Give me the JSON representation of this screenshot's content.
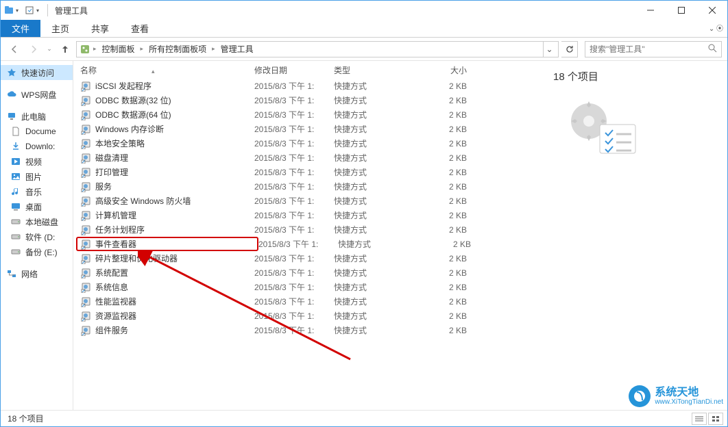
{
  "window": {
    "title": "管理工具",
    "minimize": "最小化",
    "maximize": "最大化",
    "close": "关闭"
  },
  "ribbon": {
    "file": "文件",
    "home": "主页",
    "share": "共享",
    "view": "查看"
  },
  "address": {
    "crumbs": [
      "控制面板",
      "所有控制面板项",
      "管理工具"
    ]
  },
  "search": {
    "placeholder": "搜索\"管理工具\""
  },
  "sidebar": {
    "quick_access": "快速访问",
    "wps": "WPS网盘",
    "this_pc": "此电脑",
    "documents": "Docume",
    "downloads": "Downlo:",
    "videos": "视频",
    "pictures": "图片",
    "music": "音乐",
    "desktop": "桌面",
    "local_disk": "本地磁盘",
    "software": "软件 (D:",
    "backup": "备份 (E:)",
    "network": "网络"
  },
  "columns": {
    "name": "名称",
    "date": "修改日期",
    "type": "类型",
    "size": "大小"
  },
  "files": [
    {
      "name": "iSCSI 发起程序",
      "date": "2015/8/3 下午 1:",
      "type": "快捷方式",
      "size": "2 KB",
      "hl": false
    },
    {
      "name": "ODBC 数据源(32 位)",
      "date": "2015/8/3 下午 1:",
      "type": "快捷方式",
      "size": "2 KB",
      "hl": false
    },
    {
      "name": "ODBC 数据源(64 位)",
      "date": "2015/8/3 下午 1:",
      "type": "快捷方式",
      "size": "2 KB",
      "hl": false
    },
    {
      "name": "Windows 内存诊断",
      "date": "2015/8/3 下午 1:",
      "type": "快捷方式",
      "size": "2 KB",
      "hl": false
    },
    {
      "name": "本地安全策略",
      "date": "2015/8/3 下午 1:",
      "type": "快捷方式",
      "size": "2 KB",
      "hl": false
    },
    {
      "name": "磁盘清理",
      "date": "2015/8/3 下午 1:",
      "type": "快捷方式",
      "size": "2 KB",
      "hl": false
    },
    {
      "name": "打印管理",
      "date": "2015/8/3 下午 1:",
      "type": "快捷方式",
      "size": "2 KB",
      "hl": false
    },
    {
      "name": "服务",
      "date": "2015/8/3 下午 1:",
      "type": "快捷方式",
      "size": "2 KB",
      "hl": false
    },
    {
      "name": "高级安全 Windows 防火墙",
      "date": "2015/8/3 下午 1:",
      "type": "快捷方式",
      "size": "2 KB",
      "hl": false
    },
    {
      "name": "计算机管理",
      "date": "2015/8/3 下午 1:",
      "type": "快捷方式",
      "size": "2 KB",
      "hl": false
    },
    {
      "name": "任务计划程序",
      "date": "2015/8/3 下午 1:",
      "type": "快捷方式",
      "size": "2 KB",
      "hl": false
    },
    {
      "name": "事件查看器",
      "date": "2015/8/3 下午 1:",
      "type": "快捷方式",
      "size": "2 KB",
      "hl": true
    },
    {
      "name": "碎片整理和优化驱动器",
      "date": "2015/8/3 下午 1:",
      "type": "快捷方式",
      "size": "2 KB",
      "hl": false
    },
    {
      "name": "系统配置",
      "date": "2015/8/3 下午 1:",
      "type": "快捷方式",
      "size": "2 KB",
      "hl": false
    },
    {
      "name": "系统信息",
      "date": "2015/8/3 下午 1:",
      "type": "快捷方式",
      "size": "2 KB",
      "hl": false
    },
    {
      "name": "性能监视器",
      "date": "2015/8/3 下午 1:",
      "type": "快捷方式",
      "size": "2 KB",
      "hl": false
    },
    {
      "name": "资源监视器",
      "date": "2015/8/3 下午 1:",
      "type": "快捷方式",
      "size": "2 KB",
      "hl": false
    },
    {
      "name": "组件服务",
      "date": "2015/8/3 下午 1:",
      "type": "快捷方式",
      "size": "2 KB",
      "hl": false
    }
  ],
  "preview": {
    "count_label": "18 个项目"
  },
  "status": {
    "text": "18 个项目"
  },
  "watermark": {
    "brand": "系统天地",
    "url": "www.XiTongTianDi.net"
  }
}
